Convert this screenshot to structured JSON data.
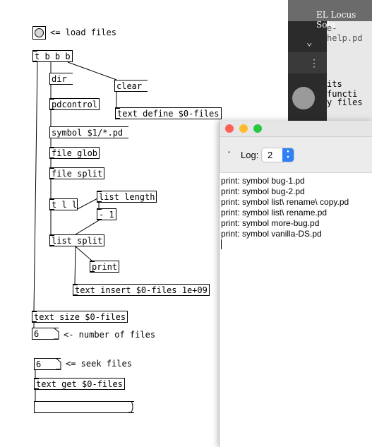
{
  "window_behind": {
    "title": "EL Locus Solu",
    "tab_fragment": "e-help.pd",
    "text_fragment_1": "its functi",
    "text_fragment_2": "y files"
  },
  "patch": {
    "load_comment": "<= load files",
    "tbbb": "t b b b",
    "dir": "dir",
    "clear": "clear",
    "pdcontrol": "pdcontrol",
    "text_define": "text define $0-files",
    "symbol_msg": "symbol $1/*.pd",
    "file_glob": "file glob",
    "file_split": "file split",
    "tll": "t l l",
    "list_length": "list length",
    "minus_one": "- 1",
    "list_split": "list split",
    "print": "print",
    "text_insert": "text insert $0-files 1e+09",
    "text_size": "text size $0-files",
    "num_files_value": "6",
    "num_files_comment": "<- number of files",
    "seek_value": "6",
    "seek_comment": "<= seek files",
    "text_get": "text get $0-files",
    "output_msg": ""
  },
  "console": {
    "log_label": "Log:",
    "log_value": "2",
    "lines": [
      "print: symbol bug-1.pd",
      "print: symbol bug-2.pd",
      "print: symbol list\\ rename\\ copy.pd",
      "print: symbol list\\ rename.pd",
      "print: symbol more-bug.pd",
      "print: symbol vanilla-DS.pd"
    ],
    "colors": {
      "close": "#fe5f57",
      "minimize": "#febc2e",
      "zoom": "#28c840",
      "accent": "#2f7ff5"
    }
  }
}
